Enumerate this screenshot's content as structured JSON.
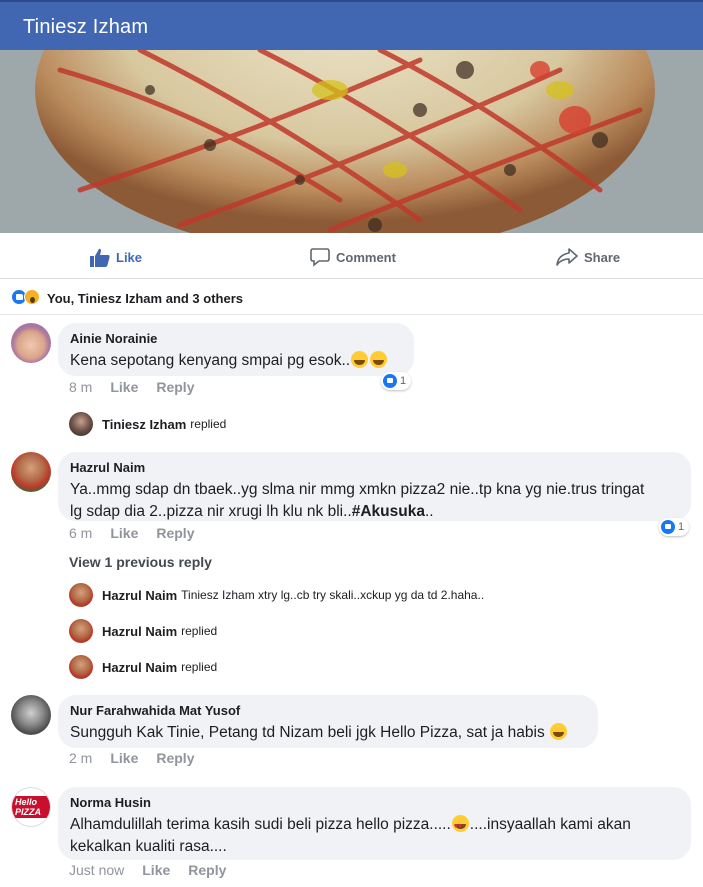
{
  "header": {
    "title": "Tiniesz Izham"
  },
  "actions": {
    "like": "Like",
    "comment": "Comment",
    "share": "Share"
  },
  "reactions": {
    "summary": "You, Tiniesz Izham and 3 others",
    "icons": [
      "like-reaction",
      "wow-reaction"
    ]
  },
  "comments": [
    {
      "name": "Ainie Norainie",
      "text": "Kena sepotang kenyang smpai pg esok..",
      "time": "8 m",
      "like": "Like",
      "reply": "Reply",
      "reactions": "1",
      "replies_summary": {
        "name": "Tiniesz Izham",
        "suffix": "replied"
      }
    },
    {
      "name": "Hazrul Naim",
      "text_line1": "Ya..mmg sdap dn tbaek..yg slma nir mmg xmkn pizza2 nie..tp kna yg nie.trus tringat",
      "text_line2_pre": "lg sdap dia 2..pizza nir xrugi lh klu nk bli..",
      "hashtag": "#Akusuka",
      "text_line2_post": "..",
      "time": "6 m",
      "like": "Like",
      "reply": "Reply",
      "reactions": "1",
      "view_previous": "View 1 previous reply",
      "replies": [
        {
          "name": "Hazrul Naim",
          "text": "Tiniesz Izham xtry lg..cb try skali..xckup yg da td 2.haha.."
        },
        {
          "name": "Hazrul Naim",
          "text": "replied"
        },
        {
          "name": "Hazrul Naim",
          "text": "replied"
        }
      ]
    },
    {
      "name": "Nur Farahwahida Mat Yusof",
      "text": "Sungguh Kak Tinie, Petang td Nizam beli jgk Hello Pizza, sat ja habis",
      "time": "2 m",
      "like": "Like",
      "reply": "Reply"
    },
    {
      "name": "Norma Husin",
      "text_line1_pre": "Alhamdulillah terima kasih sudi beli pizza hello pizza.....",
      "text_line1_post": "....insyaallah kami akan",
      "text_line2": "kekalkan kualiti rasa....",
      "time": "Just now",
      "like": "Like",
      "reply": "Reply",
      "avatar_logo": "Hello PIZZA"
    }
  ],
  "colors": {
    "brand": "#4267b2",
    "like_blue": "#1877f2",
    "bubble": "#f0f2f5",
    "meta": "#90949c"
  }
}
